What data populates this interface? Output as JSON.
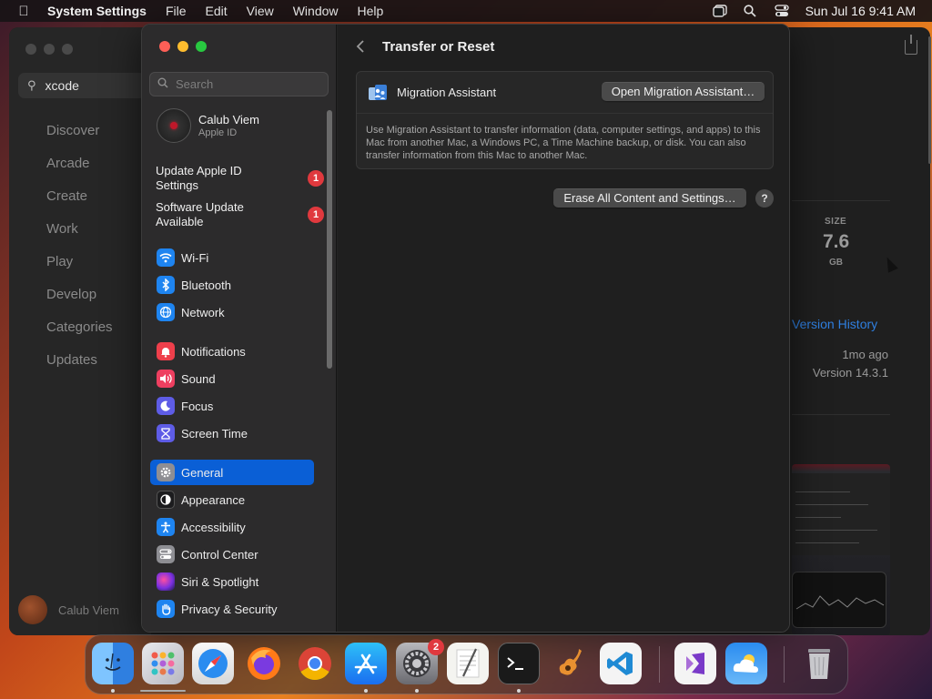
{
  "menubar": {
    "app_name": "System Settings",
    "menus": [
      "File",
      "Edit",
      "View",
      "Window",
      "Help"
    ],
    "datetime": "Sun Jul 16  9:41 AM"
  },
  "appstore": {
    "search_value": "xcode",
    "nav": [
      "Discover",
      "Arcade",
      "Create",
      "Work",
      "Play",
      "Develop",
      "Categories",
      "Updates"
    ],
    "user_name": "Calub Viem",
    "size_label": "SIZE",
    "size_value": "7.6",
    "size_unit": "GB",
    "version_history": "Version History",
    "updated": "1mo ago",
    "version": "Version 14.3.1"
  },
  "settings": {
    "search_placeholder": "Search",
    "user": {
      "name": "Calub Viem",
      "sub": "Apple ID"
    },
    "alerts": [
      {
        "label": "Update Apple ID Settings",
        "badge": "1"
      },
      {
        "label": "Software Update Available",
        "badge": "1"
      }
    ],
    "nav": [
      {
        "label": "Wi-Fi",
        "icon": "wifi-icon",
        "color": "#1e84f0"
      },
      {
        "label": "Bluetooth",
        "icon": "bluetooth-icon",
        "color": "#1e84f0"
      },
      {
        "label": "Network",
        "icon": "globe-icon",
        "color": "#1e84f0"
      },
      {
        "label": "Notifications",
        "icon": "bell-icon",
        "color": "#ee3f4b"
      },
      {
        "label": "Sound",
        "icon": "speaker-icon",
        "color": "#ee3f60"
      },
      {
        "label": "Focus",
        "icon": "moon-icon",
        "color": "#5e5ce6"
      },
      {
        "label": "Screen Time",
        "icon": "hourglass-icon",
        "color": "#5e5ce6"
      },
      {
        "label": "General",
        "icon": "gear-icon",
        "color": "#8e8e93"
      },
      {
        "label": "Appearance",
        "icon": "appearance-icon",
        "color": "#1c1c1e"
      },
      {
        "label": "Accessibility",
        "icon": "accessibility-icon",
        "color": "#1e84f0"
      },
      {
        "label": "Control Center",
        "icon": "control-center-icon",
        "color": "#8e8e93"
      },
      {
        "label": "Siri & Spotlight",
        "icon": "siri-icon",
        "color": "#c23cd8"
      },
      {
        "label": "Privacy & Security",
        "icon": "hand-icon",
        "color": "#1e84f0"
      }
    ],
    "selected": "General",
    "content": {
      "title": "Transfer or Reset",
      "migration_label": "Migration Assistant",
      "migration_button": "Open Migration Assistant…",
      "migration_desc": "Use Migration Assistant to transfer information (data, computer settings, and apps) to this Mac from another Mac, a Windows PC, a Time Machine backup, or disk. You can also transfer information from this Mac to another Mac.",
      "erase_button": "Erase All Content and Settings…",
      "help_label": "?"
    }
  },
  "dock": {
    "apps": [
      "Finder",
      "Launchpad",
      "Safari",
      "Firefox",
      "Chrome",
      "App Store",
      "System Settings",
      "TextEdit",
      "Terminal",
      "GarageBand",
      "Visual Studio Code",
      "Visual Studio",
      "Weather",
      "Trash"
    ],
    "system_settings_badge": "2"
  }
}
